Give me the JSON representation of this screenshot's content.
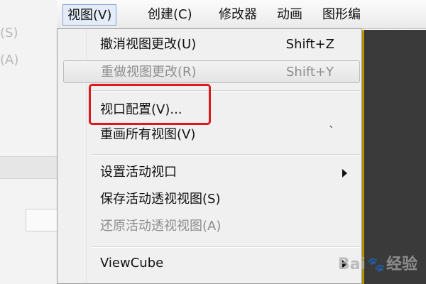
{
  "background": {
    "left_stub_1": "(S)",
    "left_stub_2": "(A)"
  },
  "menubar": {
    "items": [
      "视图(V)",
      "创建(C)",
      "修改器",
      "动画",
      "图形编"
    ]
  },
  "menu": {
    "items": [
      {
        "label": "撤消视图更改(U)",
        "shortcut": "Shift+Z"
      },
      {
        "label": "重做视图更改(R)",
        "shortcut": "Shift+Y"
      },
      {
        "label": "视口配置(V)..."
      },
      {
        "label": "重画所有视图(V)",
        "shortcut": "`"
      },
      {
        "label": "设置活动视口"
      },
      {
        "label": "保存活动透视视图(S)"
      },
      {
        "label": "还原活动透视视图(A)"
      },
      {
        "label": "ViewCube"
      }
    ]
  },
  "watermark": {
    "text1": "Bai",
    "text2": "经验"
  },
  "colors": {
    "highlight": "#e0181c",
    "viewport_border": "#e3b400"
  }
}
